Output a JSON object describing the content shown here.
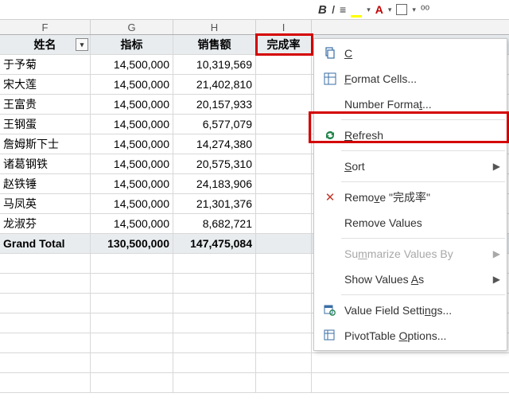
{
  "columns": {
    "F": "F",
    "G": "G",
    "H": "H",
    "I": "I"
  },
  "header": {
    "name": "姓名",
    "metric": "指标",
    "sales": "销售额",
    "rate": "完成率"
  },
  "rows": [
    {
      "name": "于予菊",
      "metric": "14,500,000",
      "sales": "10,319,569"
    },
    {
      "name": "宋大莲",
      "metric": "14,500,000",
      "sales": "21,402,810"
    },
    {
      "name": "王富贵",
      "metric": "14,500,000",
      "sales": "20,157,933"
    },
    {
      "name": "王钢蛋",
      "metric": "14,500,000",
      "sales": "6,577,079"
    },
    {
      "name": "詹姆斯下士",
      "metric": "14,500,000",
      "sales": "14,274,380"
    },
    {
      "name": "诸葛钢铁",
      "metric": "14,500,000",
      "sales": "20,575,310"
    },
    {
      "name": "赵铁锤",
      "metric": "14,500,000",
      "sales": "24,183,906"
    },
    {
      "name": "马凤英",
      "metric": "14,500,000",
      "sales": "21,301,376"
    },
    {
      "name": "龙淑芬",
      "metric": "14,500,000",
      "sales": "8,682,721"
    }
  ],
  "total": {
    "name": "Grand Total",
    "metric": "130,500,000",
    "sales": "147,475,084"
  },
  "menu": {
    "copy": "Copy",
    "format_cells": "Format Cells...",
    "number_format": "Number Format...",
    "refresh": "Refresh",
    "sort": "Sort",
    "remove_field": "Remove \"完成率\"",
    "remove_values": "Remove Values",
    "summarize": "Summarize Values By",
    "show_as": "Show Values As",
    "field_settings": "Value Field Settings...",
    "pivot_options": "PivotTable Options..."
  },
  "chart_data": {
    "type": "table",
    "title": "",
    "columns": [
      "姓名",
      "指标",
      "销售额",
      "完成率"
    ],
    "rows": [
      [
        "于予菊",
        14500000,
        10319569,
        null
      ],
      [
        "宋大莲",
        14500000,
        21402810,
        null
      ],
      [
        "王富贵",
        14500000,
        20157933,
        null
      ],
      [
        "王钢蛋",
        14500000,
        6577079,
        null
      ],
      [
        "詹姆斯下士",
        14500000,
        14274380,
        null
      ],
      [
        "诸葛钢铁",
        14500000,
        20575310,
        null
      ],
      [
        "赵铁锤",
        14500000,
        24183906,
        null
      ],
      [
        "马凤英",
        14500000,
        21301376,
        null
      ],
      [
        "龙淑芬",
        14500000,
        8682721,
        null
      ]
    ],
    "totals": [
      "Grand Total",
      130500000,
      147475084,
      null
    ]
  }
}
